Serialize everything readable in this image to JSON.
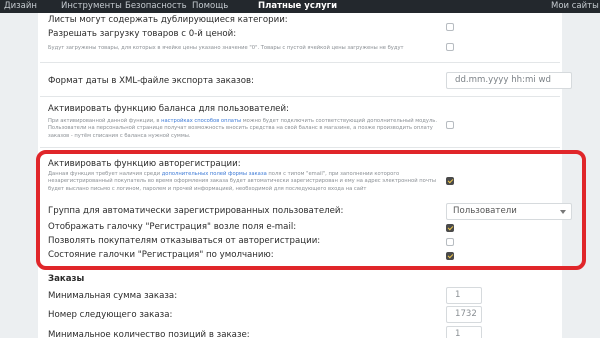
{
  "topnav": {
    "items": [
      "Дизайн",
      "Инструменты",
      "Безопасность",
      "Помощь"
    ],
    "active": "Платные услуги",
    "right": "Мои сайты"
  },
  "settings": {
    "dup_categories_label": "Листы могут содержать дублирующиеся категории:",
    "zero_price_label": "Разрешать загрузку товаров с 0-й ценой:",
    "zero_price_note": "Будут загружены товары, для которых в ячейке цены указано значение \"0\". Товары с пустой ячейкой цены загружены не будут",
    "date_format_label": "Формат даты в XML-файле экспорта заказов:",
    "date_format_value": "dd.mm.yyyy hh:mi wd",
    "balance_label": "Активировать функцию баланса для пользователей:",
    "balance_note_1": "При активированной данной функции, в ",
    "balance_note_link": "настройках способов оплаты",
    "balance_note_2": " можно будет подключить соответствующий дополнительный модуль. Пользователи на персональной странице получат возможность вносить средства на свой баланс в магазине, а позже производить оплату заказов - путём списания с баланса нужной суммы.",
    "autoreg_label": "Активировать функцию авторегистрации:",
    "autoreg_note_1": "Данная функция требует наличия среди ",
    "autoreg_note_link": "дополнительных полей формы заказа",
    "autoreg_note_2": " поля с типом \"email\", при заполнении которого незарегистрированный покупатель во время оформления заказа будет автоматически зарегистрирован и ему на адрес электронной почты будет выслано письмо с логином, паролем и прочей информацией, необходимой для последующего входа на сайт",
    "group_label": "Группа для автоматически зарегистрированных пользователей:",
    "group_value": "Пользователи",
    "show_checkbox_label": "Отображать галочку \"Регистрация\" возле поля e-mail:",
    "allow_refuse_label": "Позволять покупателям отказываться от авторегистрации:",
    "default_state_label": "Состояние галочки \"Регистрация\" по умолчанию:"
  },
  "orders": {
    "section_title": "Заказы",
    "min_sum_label": "Минимальная сумма заказа:",
    "min_sum_value": "1",
    "next_number_label": "Номер следующего заказа:",
    "next_number_value": "1732",
    "min_items_label": "Минимальное количество позиций в заказе:",
    "min_items_value": "1"
  },
  "colors": {
    "highlight": "#e0262a",
    "topbar": "#23282d",
    "link": "#3d7ad6"
  }
}
